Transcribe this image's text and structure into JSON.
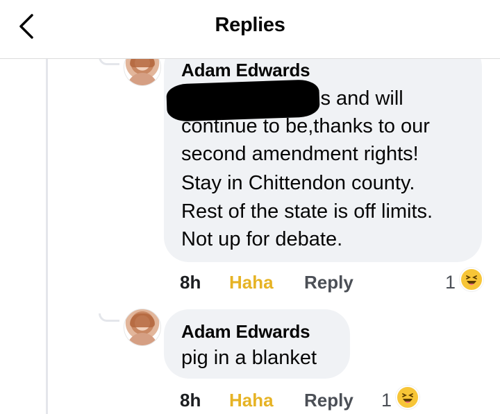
{
  "header": {
    "title": "Replies",
    "back_icon": "chevron-left-icon"
  },
  "comments": [
    {
      "author": "Adam Edwards",
      "text_lines": [
        "is and will",
        "continue to be,thanks to our",
        "second amendment rights!",
        "Stay in Chittendon county.",
        "Rest of the state is off limits.",
        "Not up for debate."
      ],
      "actions": {
        "time": "8h",
        "reaction": "Haha",
        "reply": "Reply"
      },
      "reaction_count": "1",
      "reaction_icon": "haha-emoji-icon"
    },
    {
      "author": "Adam Edwards",
      "text_lines": [
        "pig in a blanket"
      ],
      "actions": {
        "time": "8h",
        "reaction": "Haha",
        "reply": "Reply"
      },
      "reaction_count": "1",
      "reaction_icon": "haha-emoji-icon"
    }
  ],
  "colors": {
    "bubble": "#f0f2f5",
    "haha": "#e6b325",
    "muted": "#4b4f56",
    "emoji": "#f7c537"
  }
}
